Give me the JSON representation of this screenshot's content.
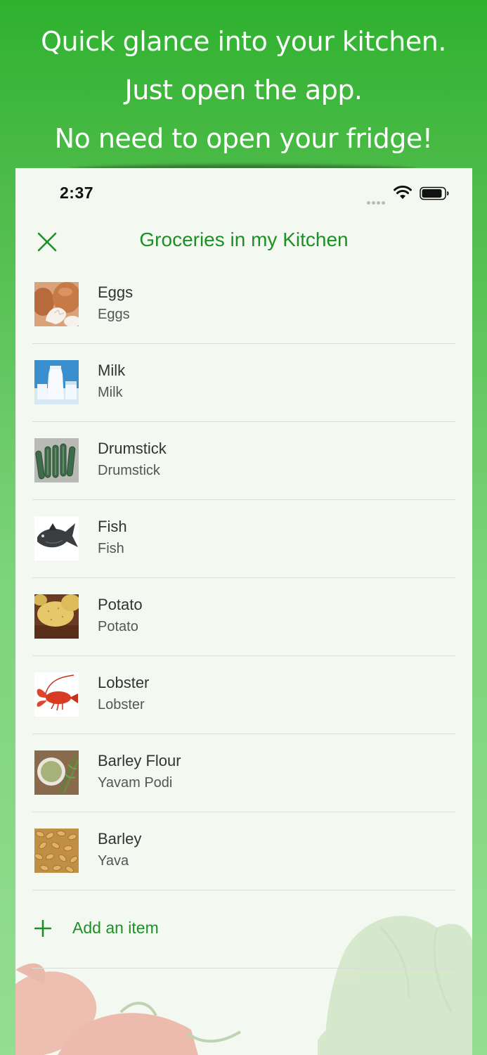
{
  "promo": {
    "line1": "Quick glance into your kitchen.",
    "line2": "Just open the app.",
    "line3": "No need to open your fridge!"
  },
  "status_bar": {
    "time": "2:37"
  },
  "nav": {
    "title": "Groceries in my Kitchen",
    "close_icon": "close-icon"
  },
  "items": [
    {
      "title": "Eggs",
      "subtitle": "Eggs",
      "icon": "eggs-photo"
    },
    {
      "title": "Milk",
      "subtitle": "Milk",
      "icon": "milk-photo"
    },
    {
      "title": "Drumstick",
      "subtitle": "Drumstick",
      "icon": "drumstick-photo"
    },
    {
      "title": "Fish",
      "subtitle": "Fish",
      "icon": "fish-photo"
    },
    {
      "title": "Potato",
      "subtitle": "Potato",
      "icon": "potato-photo"
    },
    {
      "title": "Lobster",
      "subtitle": "Lobster",
      "icon": "lobster-photo"
    },
    {
      "title": "Barley Flour",
      "subtitle": "Yavam Podi",
      "icon": "barley-flour-photo"
    },
    {
      "title": "Barley",
      "subtitle": "Yava",
      "icon": "barley-photo"
    }
  ],
  "add_item": {
    "label": "Add an item",
    "icon": "plus-icon"
  },
  "colors": {
    "accent": "#1e8f26",
    "background_green": "#2fb12f",
    "sheet": "#f3f9f1"
  }
}
